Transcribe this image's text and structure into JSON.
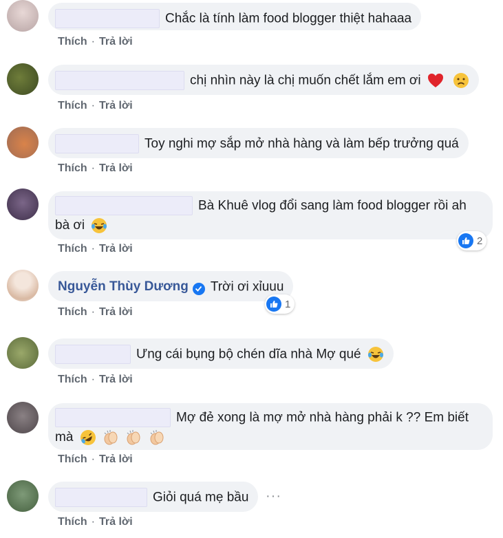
{
  "actions": {
    "like": "Thích",
    "reply": "Trả lời",
    "separator": "·"
  },
  "comments": [
    {
      "text": "Chắc là tính làm food blogger thiệt hahaaa"
    },
    {
      "text": "chị nhìn này là chị muốn chết lắm em ơi"
    },
    {
      "text": "Toy nghi mợ sắp mở nhà hàng và làm bếp trưởng quá"
    },
    {
      "text_line1": "Bà Khuê vlog đổi sang làm food blogger rồi ah",
      "text_line2": "bà ơi",
      "reactions": "2"
    },
    {
      "author": "Nguyễn Thùy Dương",
      "text": "Trời ơi xỉuuu",
      "reactions": "1"
    },
    {
      "text": "Ưng cái bụng bộ chén dĩa nhà Mợ qué"
    },
    {
      "text_line1": "Mợ đẻ xong là mợ mở nhà hàng phải k ?? Em biết",
      "text_line2": "mà"
    },
    {
      "text": "Giỏi quá mẹ bầu",
      "more": "···"
    }
  ],
  "colors": {
    "bubble": "#f0f2f5",
    "link": "#385898",
    "like_blue": "#1877f2",
    "meta": "#606770"
  }
}
